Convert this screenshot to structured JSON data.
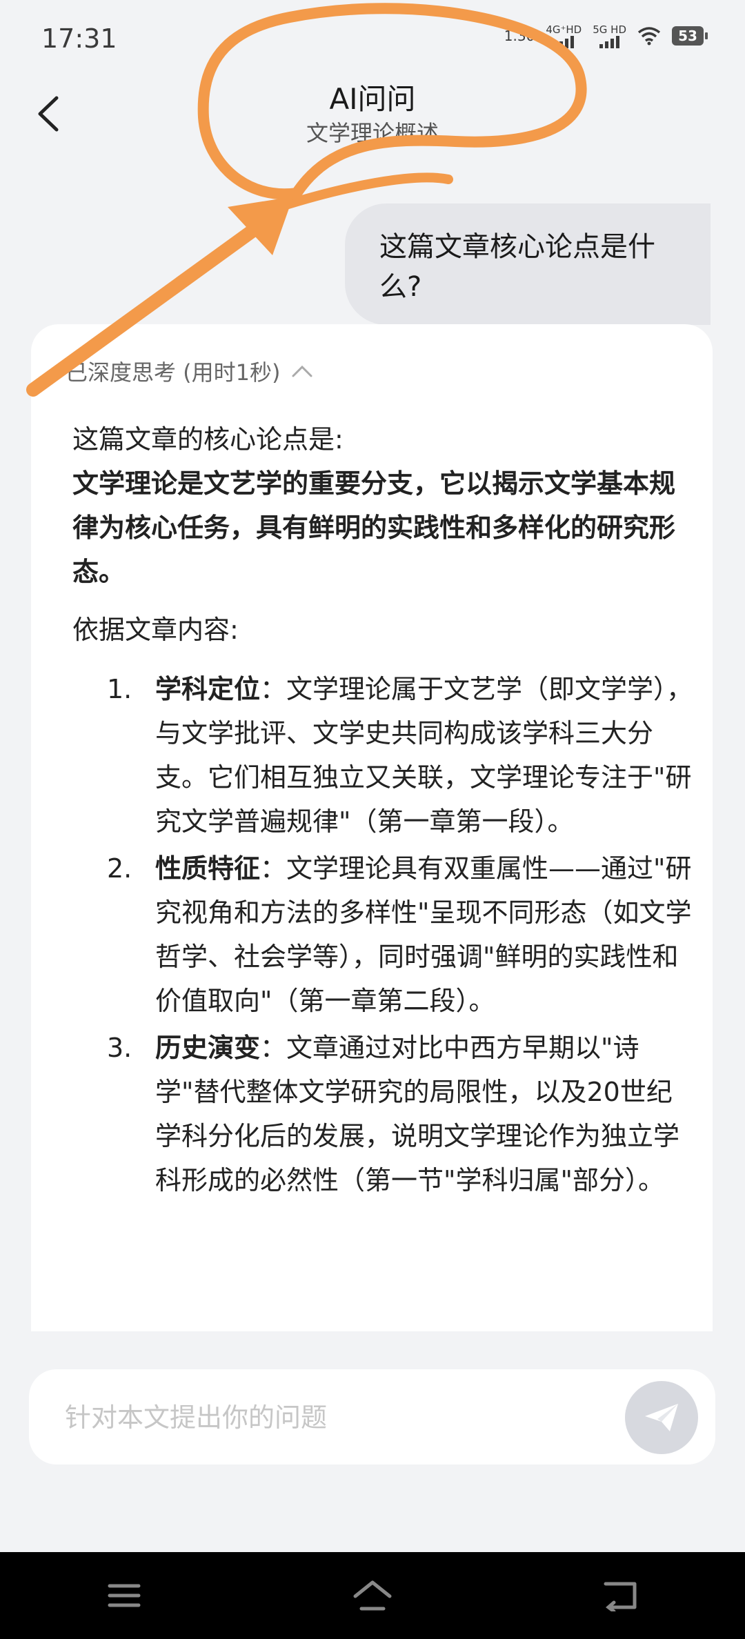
{
  "status": {
    "time": "17:31",
    "net_speed": "1.30",
    "signal1": "4G⁺HD",
    "signal2": "5G HD",
    "battery": "53"
  },
  "header": {
    "title": "AI问问",
    "subtitle": "文学理论概述"
  },
  "user_message": "这篇文章核心论点是什么?",
  "answer": {
    "thinking_label": "已深度思考 (用时1秒)",
    "lead": "这篇文章的核心论点是:",
    "core": "文学理论是文艺学的重要分支，它以揭示文学基本规律为核心任务，具有鲜明的实践性和多样化的研究形态。",
    "basis": "依据文章内容:",
    "points": [
      {
        "num": "1.",
        "title": "学科定位",
        "text": "：文学理论属于文艺学（即文学学），与文学批评、文学史共同构成该学科三大分支。它们相互独立又关联，文学理论专注于\"研究文学普遍规律\"（第一章第一段）。"
      },
      {
        "num": "2.",
        "title": "性质特征",
        "text": "：文学理论具有双重属性——通过\"研究视角和方法的多样性\"呈现不同形态（如文学哲学、社会学等），同时强调\"鲜明的实践性和价值取向\"（第一章第二段）。"
      },
      {
        "num": "3.",
        "title": "历史演变",
        "text": "：文章通过对比中西方早期以\"诗学\"替代整体文学研究的局限性，以及20世纪学科分化后的发展，说明文学理论作为独立学科形成的必然性（第一节\"学科归属\"部分）。"
      }
    ]
  },
  "input": {
    "placeholder": "针对本文提出你的问题"
  },
  "icons": {
    "back": "back-arrow-icon",
    "expand": "chevron-up-icon",
    "send": "send-icon",
    "menu": "menu-icon",
    "home": "home-icon",
    "return": "return-icon"
  },
  "colors": {
    "annotation": "#f39a4a",
    "send_button": "#d7d9df"
  }
}
